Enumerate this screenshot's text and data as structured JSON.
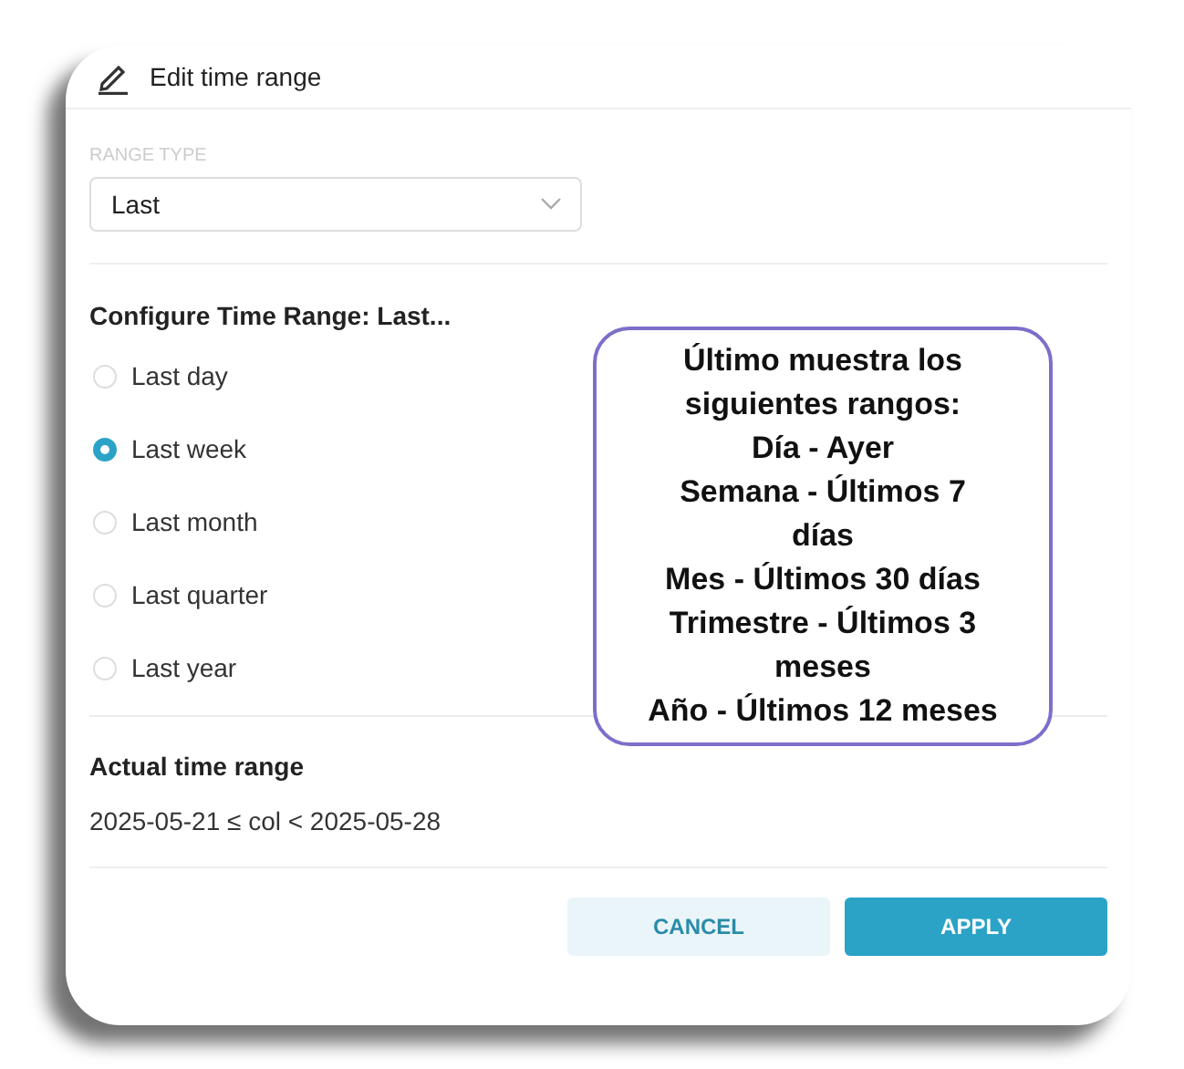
{
  "dialog": {
    "title": "Edit time range"
  },
  "range_type": {
    "label": "RANGE TYPE",
    "value": "Last"
  },
  "configure": {
    "heading": "Configure Time Range: Last...",
    "options": [
      {
        "label": "Last day",
        "selected": false
      },
      {
        "label": "Last week",
        "selected": true
      },
      {
        "label": "Last month",
        "selected": false
      },
      {
        "label": "Last quarter",
        "selected": false
      },
      {
        "label": "Last year",
        "selected": false
      }
    ]
  },
  "callout": {
    "lines": [
      "Último muestra los",
      "siguientes rangos:",
      "Día - Ayer",
      "Semana - Últimos 7",
      "días",
      "Mes - Últimos 30 días",
      "Trimestre - Últimos 3",
      "meses",
      "Año - Últimos 12 meses"
    ]
  },
  "actual": {
    "heading": "Actual time range",
    "value": "2025-05-21 ≤ col < 2025-05-28"
  },
  "buttons": [
    {
      "label": "CANCEL",
      "kind": "secondary"
    },
    {
      "label": "APPLY",
      "kind": "primary"
    }
  ]
}
